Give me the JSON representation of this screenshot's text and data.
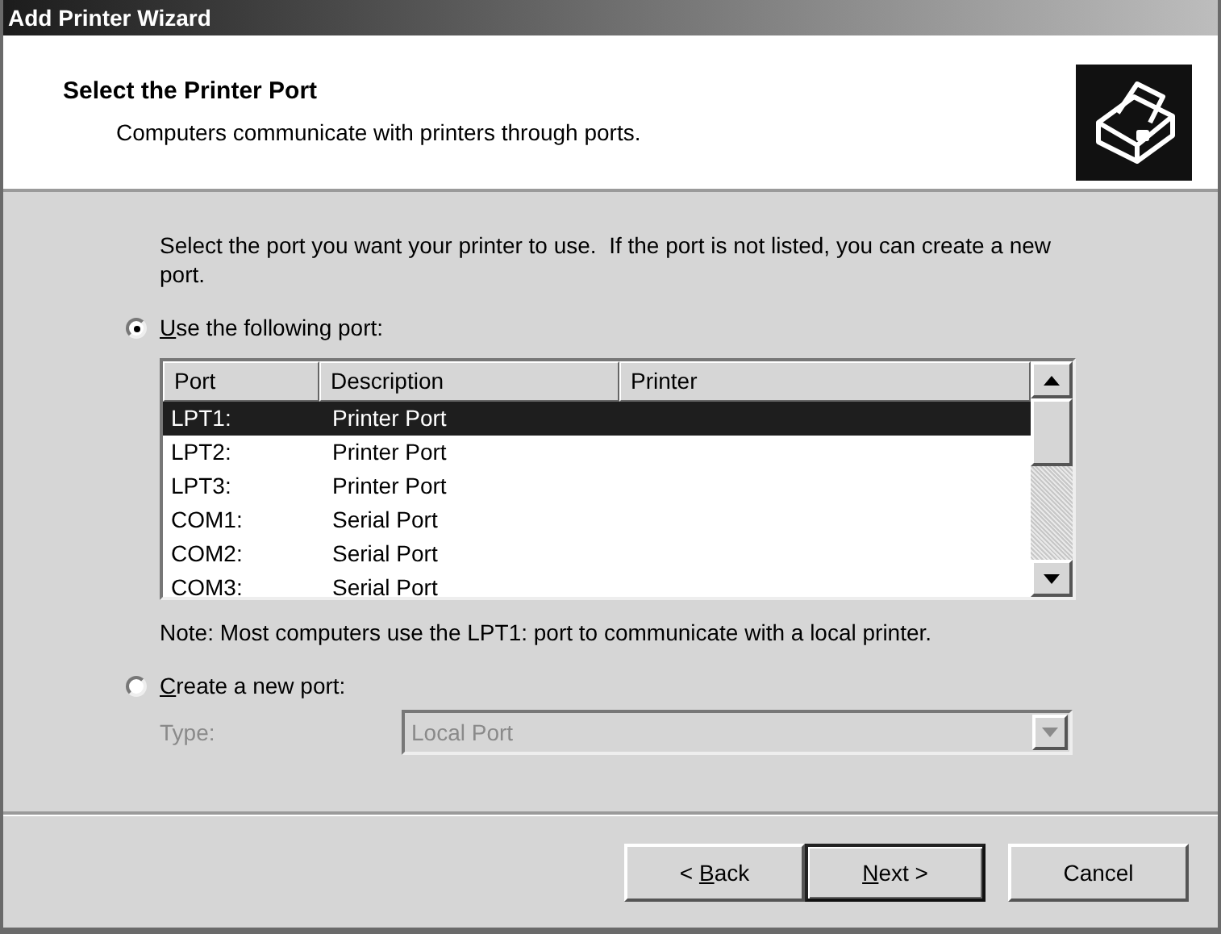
{
  "window": {
    "title": "Add Printer Wizard"
  },
  "header": {
    "title": "Select the Printer Port",
    "subtitle": "Computers communicate with printers through ports."
  },
  "instructions": "Select the port you want your printer to use.  If the port is not listed, you can create a new port.",
  "port_option": {
    "label": {
      "key": "U",
      "post": "se the following port:"
    },
    "selected": true
  },
  "port_list": {
    "columns": [
      "Port",
      "Description",
      "Printer"
    ],
    "rows": [
      {
        "port": "LPT1:",
        "description": "Printer Port",
        "selected": true
      },
      {
        "port": "LPT2:",
        "description": "Printer Port",
        "selected": false
      },
      {
        "port": "LPT3:",
        "description": "Printer Port",
        "selected": false
      },
      {
        "port": "COM1:",
        "description": "Serial Port",
        "selected": false
      },
      {
        "port": "COM2:",
        "description": "Serial Port",
        "selected": false
      },
      {
        "port": "COM3:",
        "description": "Serial Port",
        "selected": false
      }
    ]
  },
  "note": "Note: Most computers use the LPT1: port to communicate with a local printer.",
  "new_port_option": {
    "label": {
      "key": "C",
      "post": "reate a new port:"
    },
    "selected": false
  },
  "type_field": {
    "label": "Type:",
    "value": "Local Port",
    "disabled": true
  },
  "buttons": [
    {
      "label": {
        "pre": "< ",
        "key": "B",
        "post": "ack"
      },
      "default": false
    },
    {
      "label": {
        "key": "N",
        "post": "ext >"
      },
      "default": true
    },
    {
      "label": {
        "pre": "Cancel"
      },
      "default": false
    }
  ]
}
